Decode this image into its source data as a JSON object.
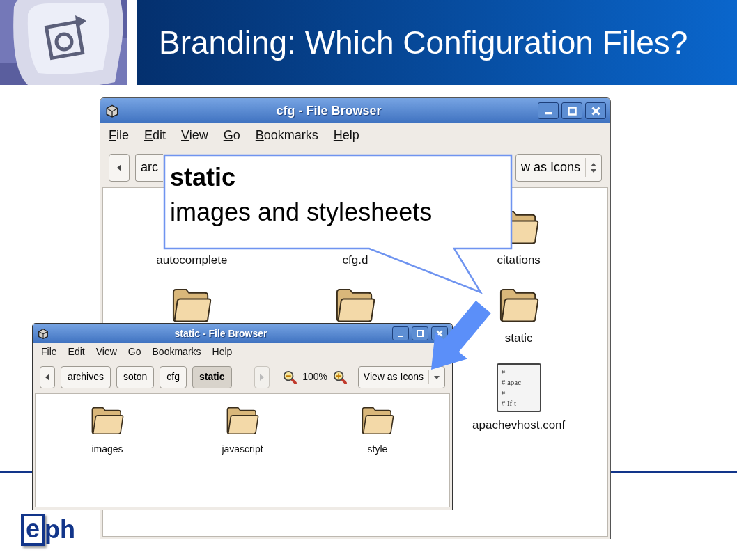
{
  "slide": {
    "title": "Branding: Which Configuration Files?",
    "logo": {
      "boxed": "e",
      "rest": "ph"
    }
  },
  "main_window": {
    "title": "cfg - File Browser",
    "menu": [
      "File",
      "Edit",
      "View",
      "Go",
      "Bookmarks",
      "Help"
    ],
    "path_buttons": [
      {
        "label": "arc",
        "selected": false
      }
    ],
    "view_select": "w as Icons",
    "items": [
      {
        "kind": "label-only",
        "name": "autocomplete"
      },
      {
        "kind": "label-only",
        "name": "cfg.d"
      },
      {
        "kind": "folder",
        "name": "citations"
      },
      {
        "kind": "folder"
      },
      {
        "kind": "folder"
      },
      {
        "kind": "folder",
        "name": "static"
      },
      {
        "kind": "blank"
      },
      {
        "kind": "blank"
      },
      {
        "kind": "text-file",
        "name": "apachevhost.conf",
        "preview": [
          "#",
          "# apac",
          "#",
          "# If t"
        ]
      }
    ]
  },
  "callout": {
    "title": "static",
    "text": "images and stylesheets"
  },
  "detail_window": {
    "title": "static - File Browser",
    "menu": [
      "File",
      "Edit",
      "View",
      "Go",
      "Bookmarks",
      "Help"
    ],
    "path_buttons": [
      {
        "label": "archives",
        "selected": false
      },
      {
        "label": "soton",
        "selected": false
      },
      {
        "label": "cfg",
        "selected": false
      },
      {
        "label": "static",
        "selected": true
      }
    ],
    "forward_disabled": true,
    "zoom": "100%",
    "view_select": "View as Icons",
    "items": [
      {
        "kind": "folder",
        "name": "images"
      },
      {
        "kind": "folder",
        "name": "javascript"
      },
      {
        "kind": "folder",
        "name": "style"
      }
    ]
  }
}
